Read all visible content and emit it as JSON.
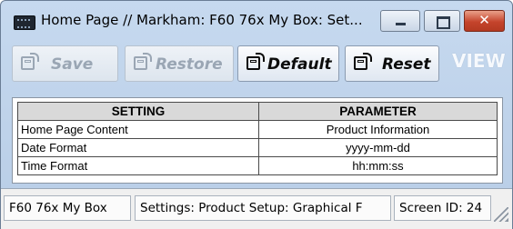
{
  "window": {
    "title": "Home Page // Markham: F60 76x My Box: Set...",
    "icon": "app-window-icon"
  },
  "titlebar_buttons": {
    "minimize": "minimize-icon",
    "maximize": "maximize-icon",
    "close": "close-icon",
    "close_glyph": "✕"
  },
  "toolbar": {
    "save_label": "Save",
    "restore_label": "Restore",
    "default_label": "Default",
    "reset_label": "Reset",
    "view_label": "VIEW",
    "save_enabled": false,
    "restore_enabled": false
  },
  "table": {
    "headers": [
      "SETTING",
      "PARAMETER"
    ],
    "rows": [
      {
        "setting": "Home Page Content",
        "parameter": "Product Information"
      },
      {
        "setting": "Date Format",
        "parameter": "yyyy-mm-dd"
      },
      {
        "setting": "Time Format",
        "parameter": "hh:mm:ss"
      }
    ]
  },
  "status": {
    "device": "F60 76x My Box",
    "settings_path": "Settings: Product Setup: Graphical F",
    "screen_id": "Screen ID: 24"
  },
  "colors": {
    "window_bg": "#c6d9ef",
    "close_button": "#c5442c",
    "header_bg": "#d9d9d9",
    "disabled_text": "#9aa6b4"
  }
}
